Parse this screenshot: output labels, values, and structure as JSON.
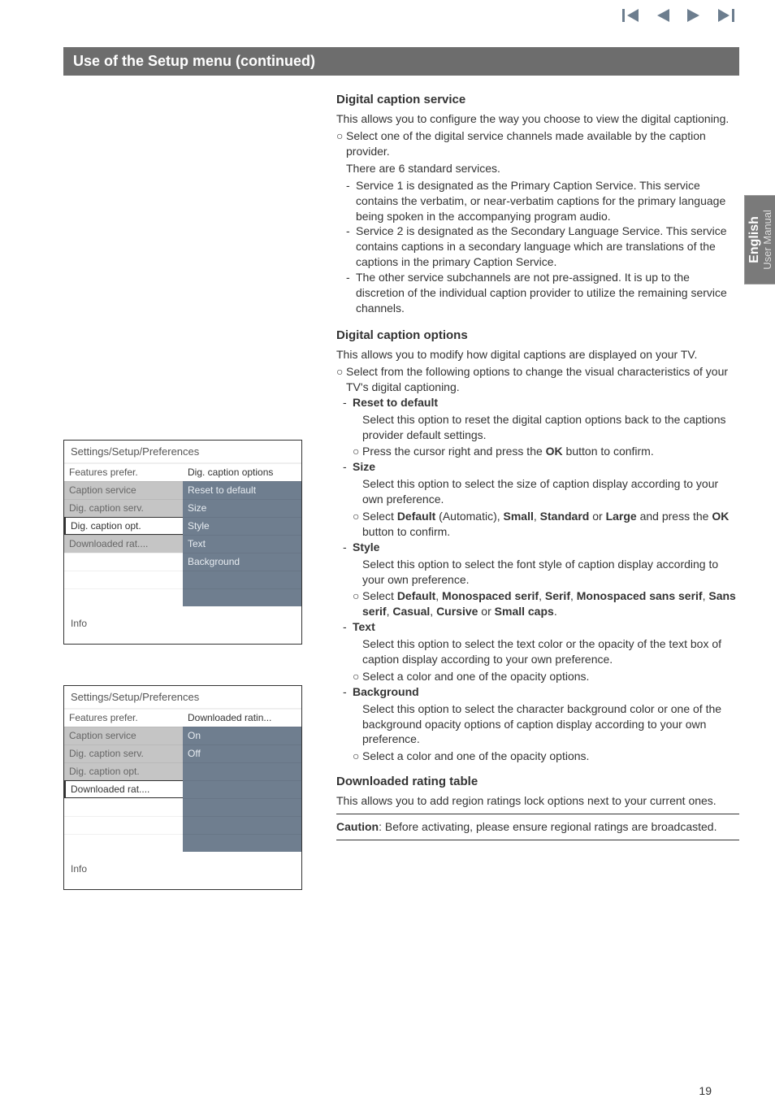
{
  "nav_icons": {
    "first": "first-icon",
    "prev": "prev-icon",
    "play": "play-icon",
    "next": "next-icon"
  },
  "banner": "Use of the Setup menu   (continued)",
  "side_tab": {
    "lang": "English",
    "sub": "User Manual"
  },
  "page_number": "19",
  "dcs": {
    "title": "Digital caption service",
    "intro": "This allows you to configure the way you choose to view the digital captioning.",
    "b1": "Select one of the digital service channels made available by the caption provider.",
    "b1_line2": "There are 6 standard services.",
    "d1": "Service 1 is designated as the Primary Caption Service. This service contains the verbatim, or near-verbatim captions for the primary language being spoken in the accompanying program audio.",
    "d2": "Service 2 is designated as the Secondary Language Service. This service contains captions in a secondary language which are translations of the captions in the primary Caption Service.",
    "d3": "The other service subchannels are not pre-assigned. It is up to the discretion of the individual caption provider to utilize the remaining service channels."
  },
  "dco": {
    "title": "Digital caption options",
    "intro": "This allows you to modify how digital captions are displayed on your TV.",
    "b1": "Select from the following options to change the visual characteristics of your TV's digital captioning.",
    "reset": {
      "head": "Reset to default",
      "body": "Select this option to reset the digital caption options back to the captions provider default settings.",
      "sub_a": "Press the cursor right and press the ",
      "sub_ok": "OK",
      "sub_b": " button to confirm."
    },
    "size": {
      "head": "Size",
      "body": "Select this option to select the size of caption display according to your own preference.",
      "sub_pre": "Select ",
      "s1": "Default",
      "s1b": " (Automatic), ",
      "s2": "Small",
      "s3": "Standard",
      "or": " or ",
      "s4": "Large",
      "sub_mid": " and press the ",
      "ok": "OK",
      "sub_post": " button to confirm."
    },
    "style": {
      "head": "Style",
      "body": "Select this option to select the font style of caption display according to your own preference.",
      "sub_pre": "Select ",
      "s1": "Default",
      "c": ", ",
      "s2": "Monospaced serif",
      "s3": "Serif",
      "s4": "Monospaced sans serif",
      "s5": "Sans serif",
      "s6": "Casual",
      "s7": "Cursive",
      "or": " or ",
      "s8": "Small caps",
      "dot": "."
    },
    "text": {
      "head": "Text",
      "body": "Select this option to select the text color or the opacity of the text box of caption display according to your own preference.",
      "sub": "Select a color and one of the opacity options."
    },
    "bg": {
      "head": "Background",
      "body": "Select this option to select the character background color or one of the background opacity options of caption display according to your own preference.",
      "sub": "Select a color and one of the opacity options."
    }
  },
  "drt": {
    "title": "Downloaded rating table",
    "body": "This allows you to add region ratings lock options next to your current ones.",
    "warn_pre": "Caution",
    "warn_post": ": Before activating, please ensure regional ratings are broadcasted."
  },
  "menu1": {
    "title": "Settings/Setup/Preferences",
    "left_head": "Features prefer.",
    "right_head": "Dig. caption options",
    "left": [
      "Caption service",
      "Dig. caption serv.",
      "Dig. caption opt.",
      "Downloaded rat...."
    ],
    "right": [
      "Reset to default",
      "Size",
      "Style",
      "Text",
      "Background"
    ],
    "info": "Info"
  },
  "menu2": {
    "title": "Settings/Setup/Preferences",
    "left_head": "Features prefer.",
    "right_head": "Downloaded ratin...",
    "left": [
      "Caption service",
      "Dig. caption serv.",
      "Dig. caption opt.",
      "Downloaded rat...."
    ],
    "right": [
      "On",
      "Off"
    ],
    "info": "Info"
  }
}
